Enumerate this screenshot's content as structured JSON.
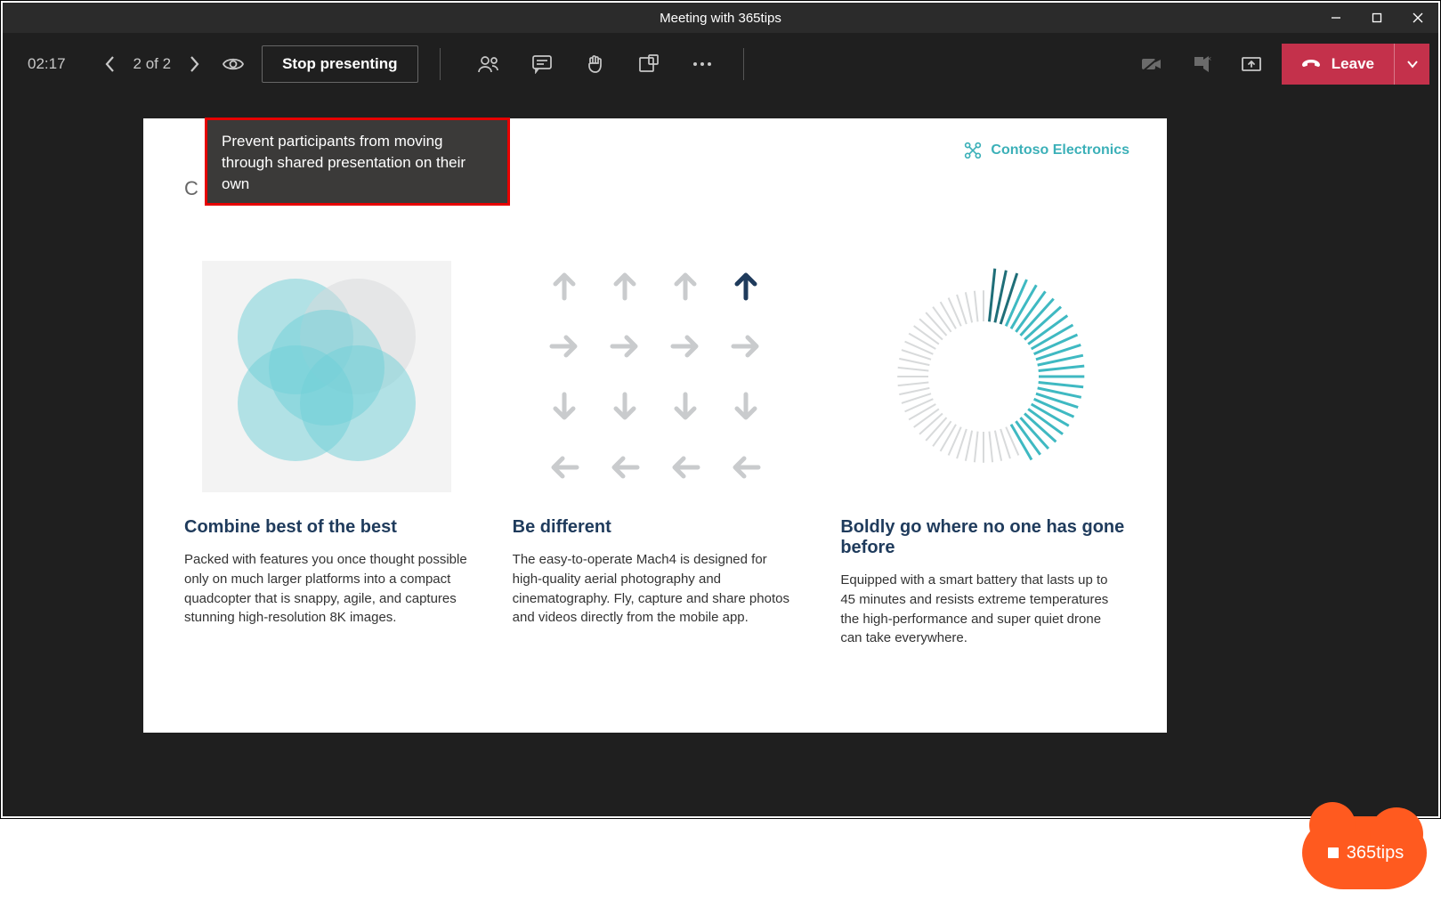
{
  "window": {
    "title": "Meeting with 365tips"
  },
  "toolbar": {
    "timer": "02:17",
    "page_count": "2 of 2",
    "stop_presenting": "Stop presenting",
    "leave": "Leave"
  },
  "tooltip": {
    "text": "Prevent participants from moving through shared presentation on their own"
  },
  "slide": {
    "brand": "Contoso Electronics",
    "title_partial": "C",
    "cols": [
      {
        "heading": "Combine best of the best",
        "body": "Packed with features you once thought possible only on much larger platforms into a compact quadcopter that is snappy, agile, and captures stunning high-resolution 8K images."
      },
      {
        "heading": "Be different",
        "body": "The easy-to-operate Mach4 is designed for high-quality aerial photography and cinematography. Fly, capture and share photos and videos directly from the mobile app."
      },
      {
        "heading": "Boldly go where no one has gone before",
        "body": "Equipped with a smart battery that lasts up to 45 minutes and resists extreme temperatures the high-performance and super quiet drone can take everywhere."
      }
    ]
  },
  "badge": {
    "label": "365tips"
  }
}
